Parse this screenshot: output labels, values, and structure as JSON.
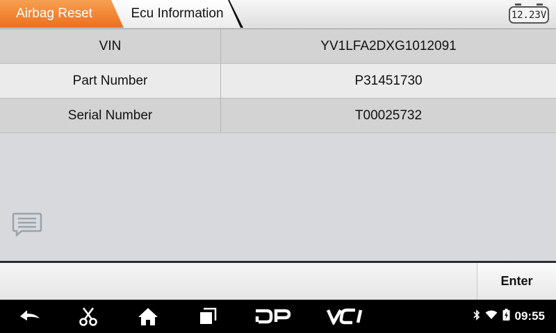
{
  "breadcrumb": {
    "items": [
      {
        "label": "Airbag Reset"
      },
      {
        "label": "Ecu Information"
      }
    ]
  },
  "battery": {
    "voltage": "12.23V"
  },
  "info_table": {
    "rows": [
      {
        "label": "VIN",
        "value": "YV1LFA2DXG1012091"
      },
      {
        "label": "Part Number",
        "value": "P31451730"
      },
      {
        "label": "Serial Number",
        "value": "T00025732"
      }
    ]
  },
  "actions": {
    "enter_label": "Enter"
  },
  "navbar": {
    "icons": [
      "back-icon",
      "scissors-icon",
      "home-icon",
      "recent-apps-icon",
      "dp-icon",
      "vci-icon"
    ],
    "dp_label": "DP",
    "vci_label": "VCI"
  },
  "status_bar": {
    "icons": [
      "bluetooth-icon",
      "wifi-icon",
      "battery-charging-icon"
    ],
    "time": "09:55"
  },
  "colors": {
    "accent_orange": "#ec6f1c",
    "row_dark": "#d3d3d3",
    "row_light": "#ebebeb"
  }
}
